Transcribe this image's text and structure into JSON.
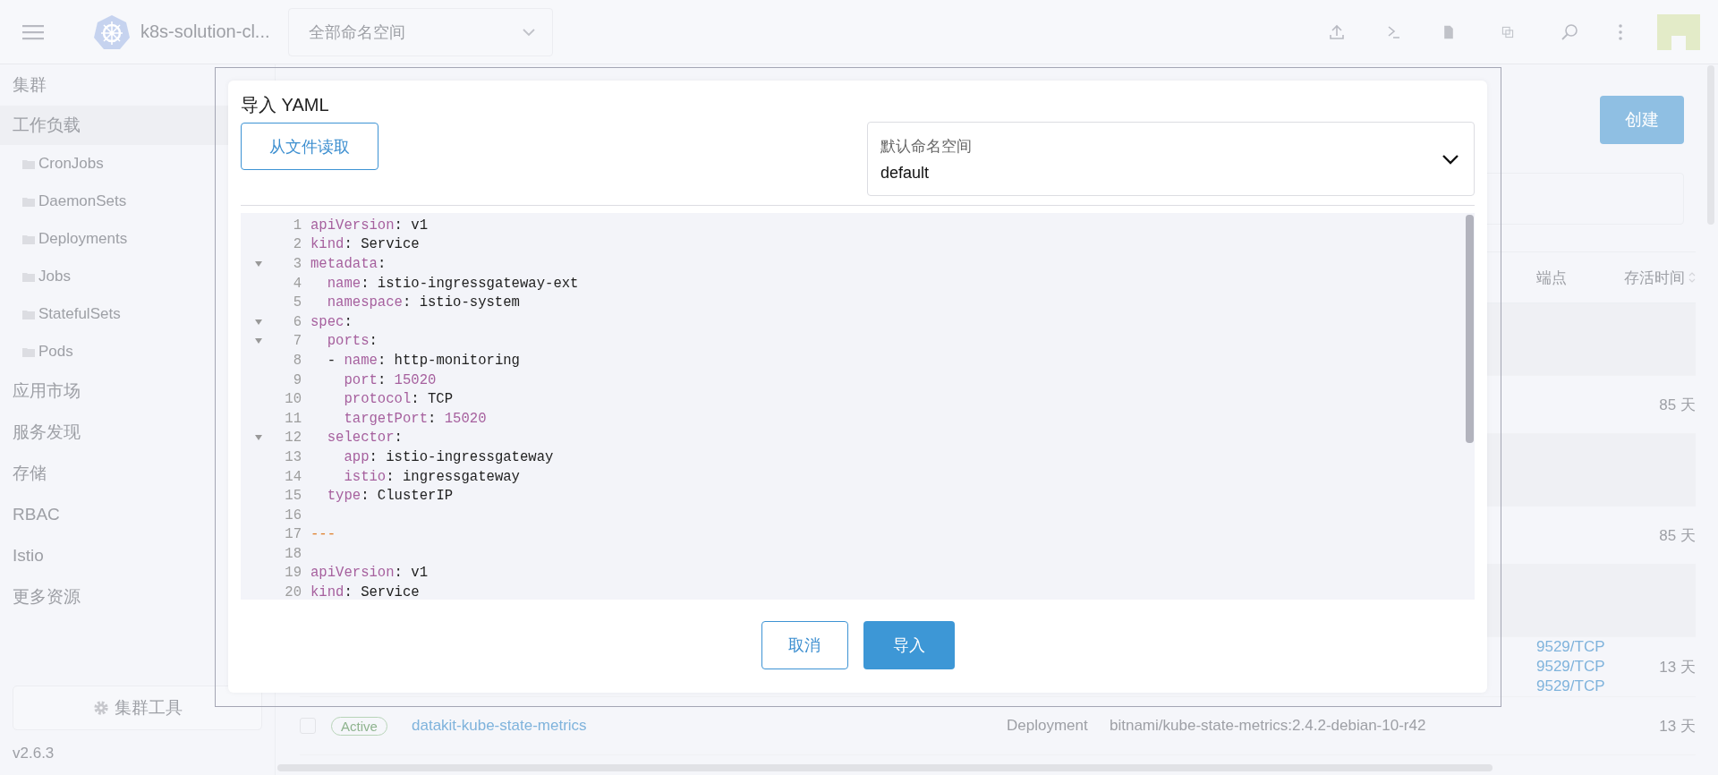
{
  "header": {
    "cluster_name": "k8s-solution-cl...",
    "namespace_select": {
      "value": "全部命名空间"
    }
  },
  "sidebar": {
    "items": [
      {
        "label": "集群",
        "selected": false
      },
      {
        "label": "工作负载",
        "selected": true,
        "children": [
          {
            "label": "CronJobs"
          },
          {
            "label": "DaemonSets"
          },
          {
            "label": "Deployments"
          },
          {
            "label": "Jobs"
          },
          {
            "label": "StatefulSets"
          },
          {
            "label": "Pods"
          }
        ]
      },
      {
        "label": "应用市场",
        "selected": false
      },
      {
        "label": "服务发现",
        "selected": false
      },
      {
        "label": "存储",
        "selected": false
      },
      {
        "label": "RBAC",
        "selected": false
      },
      {
        "label": "Istio",
        "selected": false
      },
      {
        "label": "更多资源",
        "selected": false
      }
    ],
    "cluster_tools_button": "集群工具",
    "version": "v2.6.3"
  },
  "main": {
    "create_button": "创建",
    "table": {
      "columns": [
        "端点",
        "存活时间"
      ],
      "rows": [
        {
          "kind": "detail"
        },
        {
          "kind": "row",
          "age": "85 天"
        },
        {
          "kind": "detail"
        },
        {
          "kind": "row",
          "age": "85 天"
        },
        {
          "kind": "detail"
        },
        {
          "kind": "row",
          "endpoints": [
            "9529/TCP",
            "9529/TCP",
            "9529/TCP"
          ],
          "age": "13 天"
        },
        {
          "kind": "row",
          "checked": false,
          "status": "Active",
          "name": "datakit-kube-state-metrics",
          "type": "Deployment",
          "image": "bitnami/kube-state-metrics:2.4.2-debian-10-r42",
          "age": "13 天"
        }
      ]
    }
  },
  "dialog": {
    "title": "导入 YAML",
    "file_button": "从文件读取",
    "namespace_select": {
      "label": "默认命名空间",
      "value": "default"
    },
    "editor": {
      "lines": [
        {
          "num": "1",
          "fold": false,
          "tokens": [
            {
              "kind": "key",
              "text": "apiVersion"
            },
            {
              "kind": "plain",
              "text": ": v1"
            }
          ]
        },
        {
          "num": "2",
          "fold": false,
          "tokens": [
            {
              "kind": "key",
              "text": "kind"
            },
            {
              "kind": "plain",
              "text": ": Service"
            }
          ]
        },
        {
          "num": "3",
          "fold": true,
          "tokens": [
            {
              "kind": "key",
              "text": "metadata"
            },
            {
              "kind": "plain",
              "text": ":"
            }
          ]
        },
        {
          "num": "4",
          "fold": false,
          "tokens": [
            {
              "kind": "key",
              "text": "  name"
            },
            {
              "kind": "plain",
              "text": ": istio-ingressgateway-ext"
            }
          ]
        },
        {
          "num": "5",
          "fold": false,
          "tokens": [
            {
              "kind": "key",
              "text": "  namespace"
            },
            {
              "kind": "plain",
              "text": ": istio-system"
            }
          ]
        },
        {
          "num": "6",
          "fold": true,
          "tokens": [
            {
              "kind": "key",
              "text": "spec"
            },
            {
              "kind": "plain",
              "text": ":"
            }
          ]
        },
        {
          "num": "7",
          "fold": true,
          "tokens": [
            {
              "kind": "key",
              "text": "  ports"
            },
            {
              "kind": "plain",
              "text": ":"
            }
          ]
        },
        {
          "num": "8",
          "fold": false,
          "tokens": [
            {
              "kind": "plain",
              "text": "  - "
            },
            {
              "kind": "key",
              "text": "name"
            },
            {
              "kind": "plain",
              "text": ": http-monitoring"
            }
          ]
        },
        {
          "num": "9",
          "fold": false,
          "tokens": [
            {
              "kind": "key",
              "text": "    port"
            },
            {
              "kind": "plain",
              "text": ": "
            },
            {
              "kind": "number",
              "text": "15020"
            }
          ]
        },
        {
          "num": "10",
          "fold": false,
          "tokens": [
            {
              "kind": "key",
              "text": "    protocol"
            },
            {
              "kind": "plain",
              "text": ": TCP"
            }
          ]
        },
        {
          "num": "11",
          "fold": false,
          "tokens": [
            {
              "kind": "key",
              "text": "    targetPort"
            },
            {
              "kind": "plain",
              "text": ": "
            },
            {
              "kind": "number",
              "text": "15020"
            }
          ]
        },
        {
          "num": "12",
          "fold": true,
          "tokens": [
            {
              "kind": "key",
              "text": "  selector"
            },
            {
              "kind": "plain",
              "text": ":"
            }
          ]
        },
        {
          "num": "13",
          "fold": false,
          "tokens": [
            {
              "kind": "key",
              "text": "    app"
            },
            {
              "kind": "plain",
              "text": ": istio-ingressgateway"
            }
          ]
        },
        {
          "num": "14",
          "fold": false,
          "tokens": [
            {
              "kind": "key",
              "text": "    istio"
            },
            {
              "kind": "plain",
              "text": ": ingressgateway"
            }
          ]
        },
        {
          "num": "15",
          "fold": false,
          "tokens": [
            {
              "kind": "key",
              "text": "  type"
            },
            {
              "kind": "plain",
              "text": ": ClusterIP"
            }
          ]
        },
        {
          "num": "16",
          "fold": false
        },
        {
          "num": "17",
          "fold": false,
          "tokens": [
            {
              "kind": "doc",
              "text": "---"
            }
          ]
        },
        {
          "num": "18",
          "fold": false
        },
        {
          "num": "19",
          "fold": false,
          "tokens": [
            {
              "kind": "key",
              "text": "apiVersion"
            },
            {
              "kind": "plain",
              "text": ": v1"
            }
          ]
        },
        {
          "num": "20",
          "fold": false,
          "tokens": [
            {
              "kind": "key",
              "text": "kind"
            },
            {
              "kind": "plain",
              "text": ": Service"
            }
          ]
        }
      ]
    },
    "cancel_button": "取消",
    "import_button": "导入"
  }
}
